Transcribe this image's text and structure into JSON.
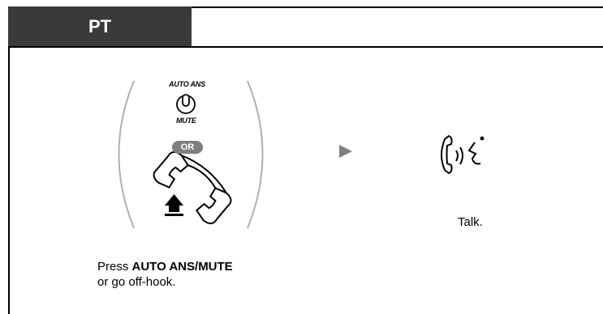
{
  "header": {
    "title": "PT"
  },
  "step1": {
    "button_top_label": "AUTO ANS",
    "button_bottom_label": "MUTE",
    "or_label": "OR",
    "caption_prefix": "Press ",
    "caption_bold": "AUTO ANS/MUTE",
    "caption_line2": "or go off-hook."
  },
  "step2": {
    "caption": "Talk."
  },
  "icons": [
    "auto-ans-mute-button-icon",
    "handset-off-hook-icon",
    "arrow-right-icon",
    "talk-icon"
  ]
}
